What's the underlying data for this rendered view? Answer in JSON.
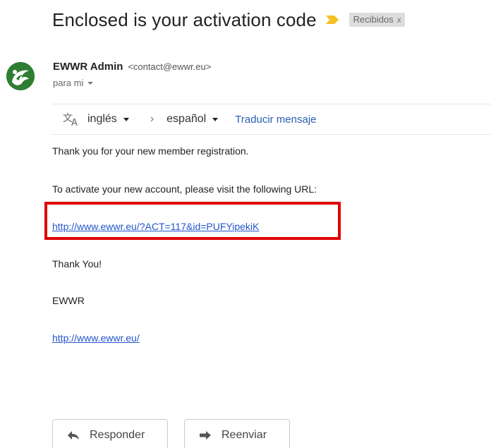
{
  "email": {
    "subject": "Enclosed is your activation code",
    "label": "Recibidos",
    "label_close": "x",
    "importance_icon": "importance-marker-icon",
    "sender": {
      "name": "EWWR Admin",
      "email": "<contact@ewwr.eu>",
      "recipient": "para mi"
    },
    "translate": {
      "from_language": "inglés",
      "to_language": "español",
      "action": "Traducir mensaje"
    },
    "body": {
      "line1": "Thank you for your new member registration.",
      "line2": "To activate your new account, please visit the following URL:",
      "activation_url": "http://www.ewwr.eu/?ACT=117&id=PUFYipekiK",
      "thanks": "Thank You!",
      "signature": "EWWR",
      "site_url": "http://www.ewwr.eu/"
    },
    "actions": {
      "reply": "Responder",
      "forward": "Reenviar"
    }
  },
  "colors": {
    "link": "#2255cc",
    "highlight": "#e00000",
    "avatar": "#2e7d32",
    "importance": "#f6c026"
  }
}
